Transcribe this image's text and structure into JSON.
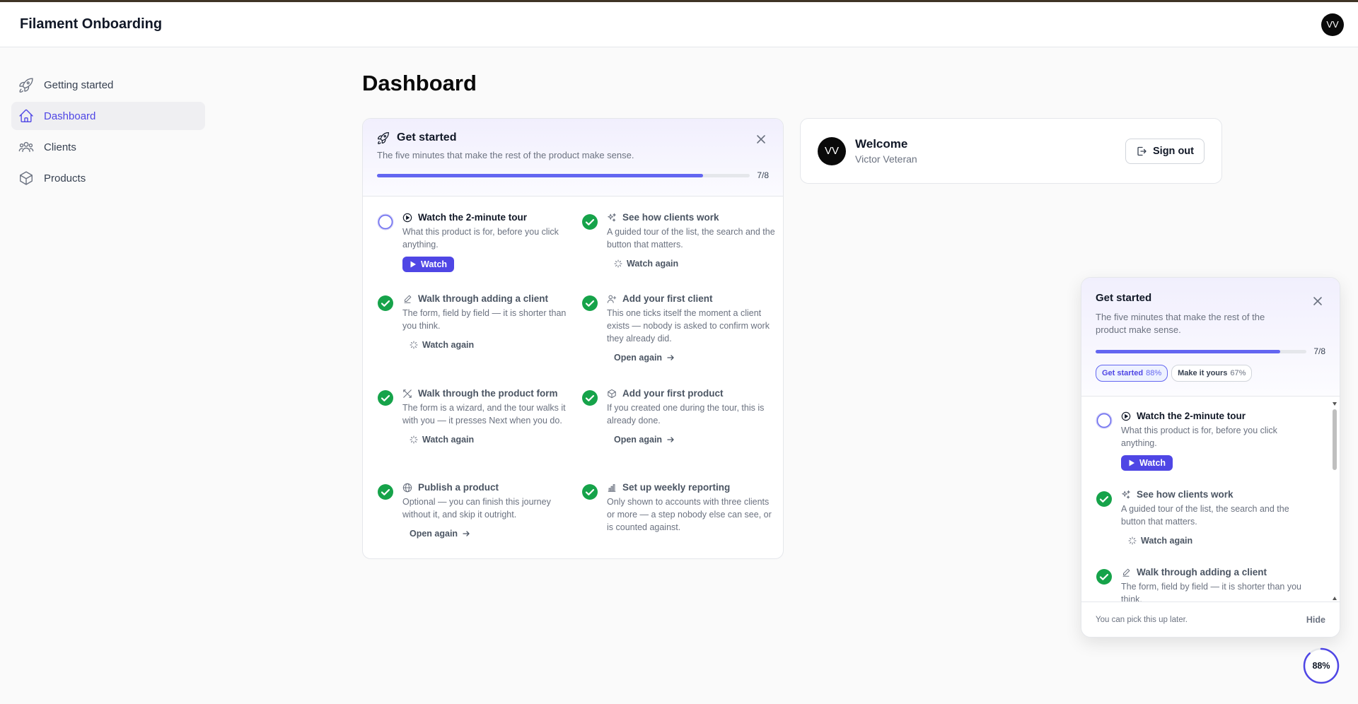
{
  "app": {
    "title": "Filament Onboarding",
    "avatar_initials": "VV"
  },
  "sidebar": {
    "items": [
      {
        "label": "Getting started",
        "icon": "rocket-icon"
      },
      {
        "label": "Dashboard",
        "icon": "home-icon",
        "active": true
      },
      {
        "label": "Clients",
        "icon": "users-icon"
      },
      {
        "label": "Products",
        "icon": "cube-icon"
      }
    ]
  },
  "page": {
    "title": "Dashboard"
  },
  "get_started": {
    "title": "Get started",
    "subtitle": "The five minutes that make the rest of the product make sense.",
    "progress_text": "7/8",
    "progress_fraction": 0.875,
    "steps": [
      {
        "title": "Watch the 2-minute tour",
        "desc": "What this product is for, before you click anything.",
        "action": "Watch",
        "done": false,
        "icon": "play-circle-icon"
      },
      {
        "title": "See how clients work",
        "desc": "A guided tour of the list, the search and the button that matters.",
        "action": "Watch again",
        "done": true,
        "icon": "sparkles-icon"
      },
      {
        "title": "Walk through adding a client",
        "desc": "The form, field by field — it is shorter than you think.",
        "action": "Watch again",
        "done": true,
        "icon": "pencil-icon"
      },
      {
        "title": "Add your first client",
        "desc": "This one ticks itself the moment a client exists — nobody is asked to confirm work they already did.",
        "action": "Open again",
        "done": true,
        "icon": "user-plus-icon"
      },
      {
        "title": "Walk through the product form",
        "desc": "The form is a wizard, and the tour walks it with you — it presses Next when you do.",
        "action": "Watch again",
        "done": true,
        "icon": "tools-icon"
      },
      {
        "title": "Add your first product",
        "desc": "If you created one during the tour, this is already done.",
        "action": "Open again",
        "done": true,
        "icon": "cube-icon"
      },
      {
        "title": "Publish a product",
        "desc": "Optional — you can finish this journey without it, and skip it outright.",
        "action": "Open again",
        "done": true,
        "icon": "globe-icon"
      },
      {
        "title": "Set up weekly reporting",
        "desc": "Only shown to accounts with three clients or more — a step nobody else can see, or is counted against.",
        "action": "",
        "done": true,
        "icon": "bar-chart-icon"
      }
    ]
  },
  "welcome": {
    "title": "Welcome",
    "name": "Victor Veteran",
    "initials": "VV",
    "signout_label": "Sign out"
  },
  "panel": {
    "title": "Get started",
    "subtitle": "The five minutes that make the rest of the product make sense.",
    "progress_text": "7/8",
    "progress_fraction": 0.875,
    "chips": [
      {
        "label": "Get started",
        "pct": "88%",
        "active": true
      },
      {
        "label": "Make it yours",
        "pct": "67%",
        "active": false
      }
    ],
    "steps": [
      {
        "title": "Watch the 2-minute tour",
        "desc": "What this product is for, before you click anything.",
        "action": "Watch",
        "done": false
      },
      {
        "title": "See how clients work",
        "desc": "A guided tour of the list, the search and the button that matters.",
        "action": "Watch again",
        "done": true
      },
      {
        "title": "Walk through adding a client",
        "desc": "The form, field by field — it is shorter than you think.",
        "action": "",
        "done": true
      }
    ],
    "footer_note": "You can pick this up later.",
    "hide_label": "Hide"
  },
  "progress_ring": {
    "label": "88%",
    "fraction": 0.88
  },
  "colors": {
    "accent": "#4f46e5",
    "progress": "#6366f1",
    "done": "#16a34a"
  }
}
